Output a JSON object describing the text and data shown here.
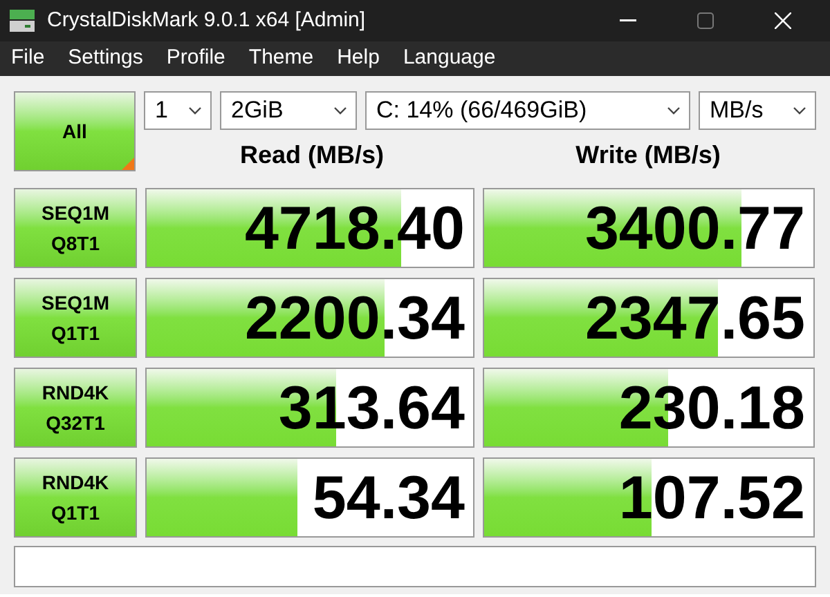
{
  "window": {
    "title": "CrystalDiskMark 9.0.1 x64 [Admin]"
  },
  "menu": [
    "File",
    "Settings",
    "Profile",
    "Theme",
    "Help",
    "Language"
  ],
  "all_button": {
    "label": "All"
  },
  "selects": [
    {
      "value": "1"
    },
    {
      "value": "2GiB"
    },
    {
      "value": "C: 14% (66/469GiB)"
    },
    {
      "value": "MB/s"
    }
  ],
  "headers": [
    "Read (MB/s)",
    "Write (MB/s)"
  ],
  "rows": [
    {
      "test": [
        "SEQ1M",
        "Q8T1"
      ],
      "read": {
        "value": "4718.40",
        "level": 0.78
      },
      "write": {
        "value": "3400.77",
        "level": 0.78
      }
    },
    {
      "test": [
        "SEQ1M",
        "Q1T1"
      ],
      "read": {
        "value": "2200.34",
        "level": 0.73
      },
      "write": {
        "value": "2347.65",
        "level": 0.71
      }
    },
    {
      "test": [
        "RND4K",
        "Q32T1"
      ],
      "read": {
        "value": "313.64",
        "level": 0.58
      },
      "write": {
        "value": "230.18",
        "level": 0.56
      }
    },
    {
      "test": [
        "RND4K",
        "Q1T1"
      ],
      "read": {
        "value": "54.34",
        "level": 0.46
      },
      "write": {
        "value": "107.52",
        "level": 0.51
      }
    }
  ]
}
